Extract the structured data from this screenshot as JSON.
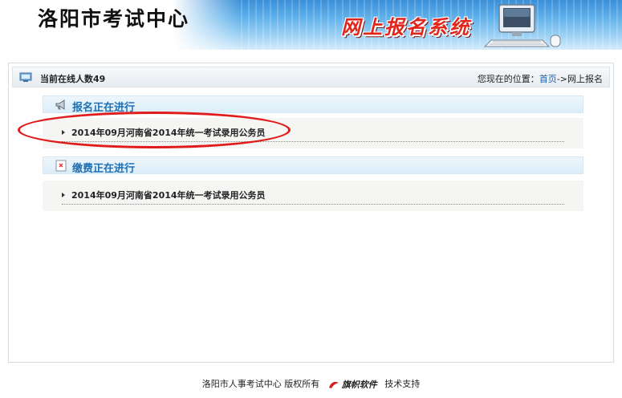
{
  "header": {
    "title": "洛阳市考试中心",
    "system_name": "网上报名系统"
  },
  "status": {
    "online_count": "当前在线人数49",
    "location_prefix": "您现在的位置：",
    "home_link": "首页",
    "location_suffix": "->网上报名"
  },
  "sections": [
    {
      "title": "报名正在进行",
      "icon": "megaphone-icon",
      "items": [
        "2014年09月河南省2014年统一考试录用公务员"
      ]
    },
    {
      "title": "缴费正在进行",
      "icon": "document-x-icon",
      "items": [
        "2014年09月河南省2014年统一考试录用公务员"
      ]
    }
  ],
  "footer": {
    "copyright": "洛阳市人事考试中心 版权所有",
    "vendor_logo": "旗帜软件",
    "support": "技术支持"
  },
  "colors": {
    "accent": "#1f6fb3",
    "annotation": "#e11a1a",
    "system_name": "#e0251b"
  }
}
